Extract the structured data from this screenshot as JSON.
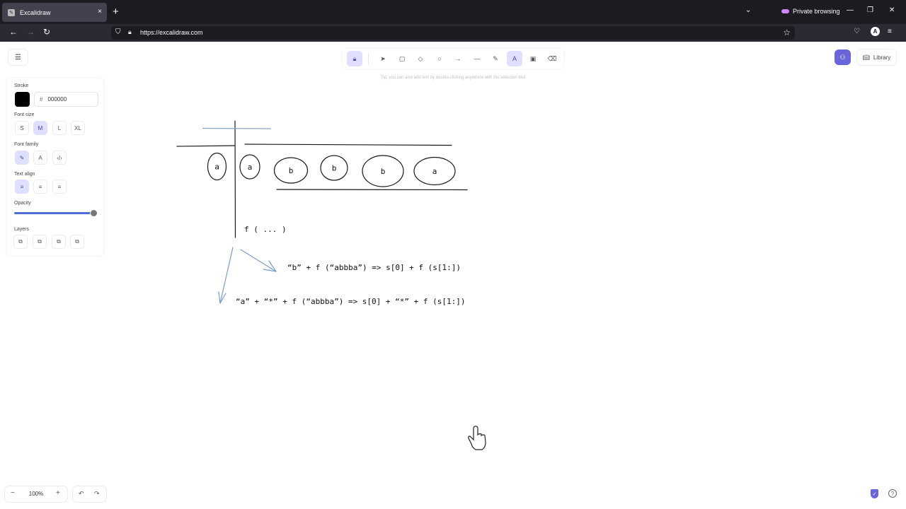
{
  "browser": {
    "tab_title": "Excalidraw",
    "tab_close": "×",
    "new_tab": "+",
    "private_label": "Private browsing",
    "url": "https://excalidraw.com"
  },
  "toolbar": {
    "hint": "Tip: you can also add text by double-clicking anywhere with the selection tool"
  },
  "top_right": {
    "library_label": "Library"
  },
  "properties": {
    "stroke_label": "Stroke",
    "stroke_hex": "000000",
    "hash": "#",
    "font_size_label": "Font size",
    "font_sizes": [
      "S",
      "M",
      "L",
      "XL"
    ],
    "font_family_label": "Font family",
    "text_align_label": "Text align",
    "opacity_label": "Opacity",
    "opacity": 1.0,
    "layers_label": "Layers"
  },
  "footer": {
    "zoom": "100%",
    "zoom_out": "−",
    "zoom_in": "+"
  },
  "canvas_text": {
    "circles": [
      "a",
      "a",
      "b",
      "b",
      "b",
      "a"
    ],
    "f_call": "f ( ... )",
    "line1": "“b” + f (“abbba”)  =>  s[0] + f (s[1:])",
    "line2": "“a” + “*” + f (“abbba”)   => s[0] + “*” + f (s[1:])"
  },
  "colors": {
    "accent": "#6965db",
    "accent_light": "#e0dfff",
    "arrow_stroke": "#7b9bd0",
    "slider": "#4a6fd8"
  }
}
